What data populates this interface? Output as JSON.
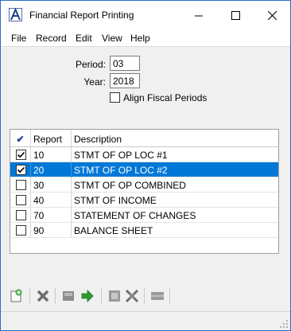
{
  "window": {
    "title": "Financial Report Printing",
    "icon": "app-logo-icon"
  },
  "menu": [
    "File",
    "Record",
    "Edit",
    "View",
    "Help"
  ],
  "form": {
    "period_label": "Period:",
    "period_value": "03",
    "year_label": "Year:",
    "year_value": "2018",
    "align_label": "Align Fiscal Periods",
    "align_checked": false
  },
  "grid": {
    "columns": [
      "✔",
      "Report",
      "Description"
    ],
    "rows": [
      {
        "checked": true,
        "report": "10",
        "description": "STMT OF OP LOC #1",
        "selected": false
      },
      {
        "checked": true,
        "report": "20",
        "description": "STMT OF OP LOC #2",
        "selected": true
      },
      {
        "checked": false,
        "report": "30",
        "description": "STMT OF OP COMBINED",
        "selected": false
      },
      {
        "checked": false,
        "report": "40",
        "description": "STMT OF INCOME",
        "selected": false
      },
      {
        "checked": false,
        "report": "70",
        "description": "STATEMENT OF CHANGES",
        "selected": false
      },
      {
        "checked": false,
        "report": "90",
        "description": "BALANCE SHEET",
        "selected": false
      }
    ]
  },
  "toolbar": {
    "icons": [
      "new-record-icon",
      "delete-icon",
      "save-icon",
      "go-icon",
      "clear-icon",
      "collapse-icon",
      "rule-icon"
    ]
  },
  "colors": {
    "selection": "#0078d7",
    "accent": "#2b6cc4"
  }
}
